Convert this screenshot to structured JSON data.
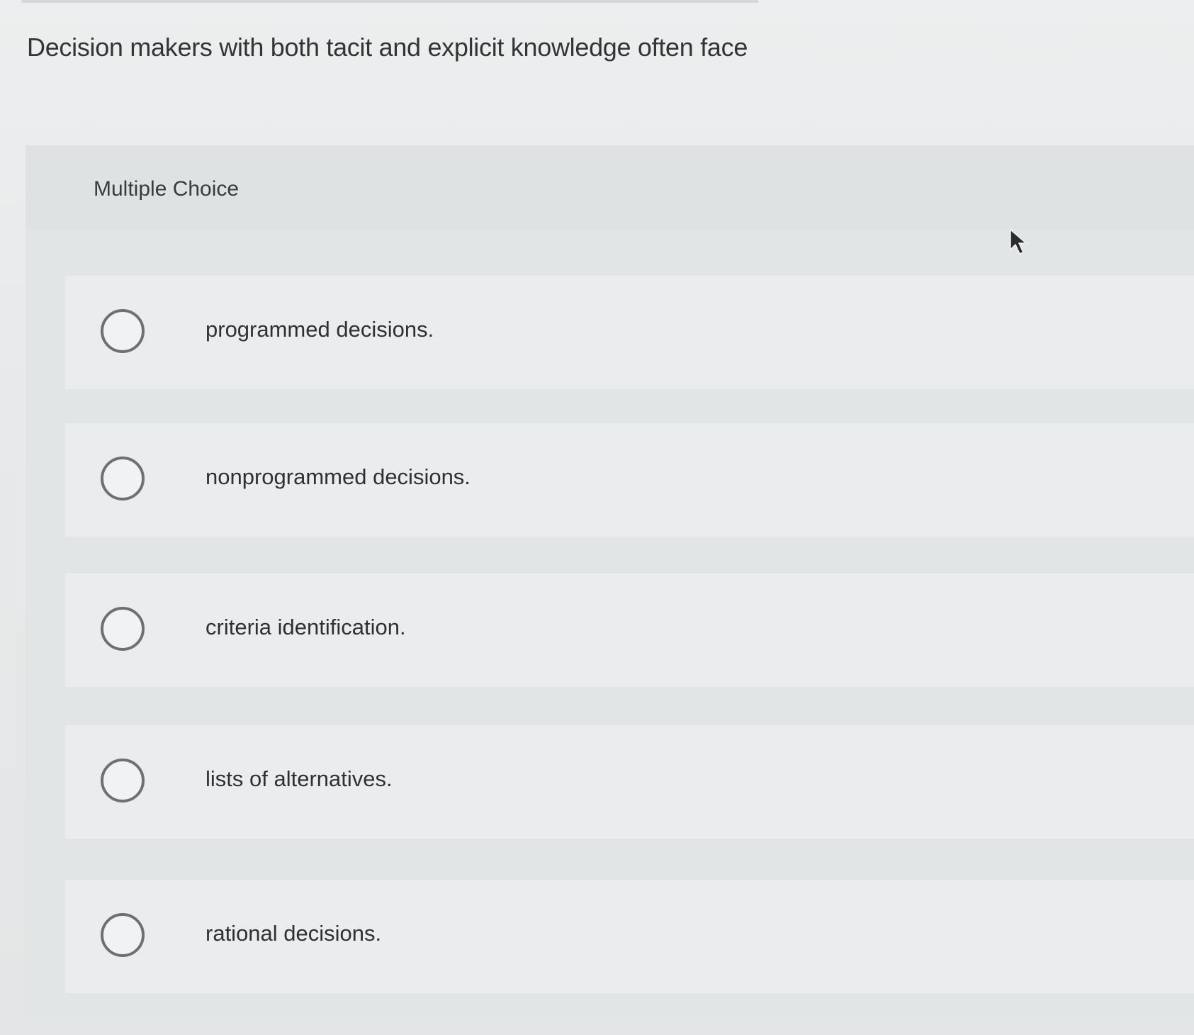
{
  "question": {
    "text": "Decision makers with both tacit and explicit knowledge often face"
  },
  "section": {
    "label": "Multiple Choice"
  },
  "options": [
    {
      "label": "programmed decisions.",
      "selected": false
    },
    {
      "label": "nonprogrammed decisions.",
      "selected": false
    },
    {
      "label": "criteria identification.",
      "selected": false
    },
    {
      "label": "lists of alternatives.",
      "selected": false
    },
    {
      "label": "rational decisions.",
      "selected": false
    }
  ],
  "cursor": {
    "icon": "mouse-pointer-icon"
  }
}
